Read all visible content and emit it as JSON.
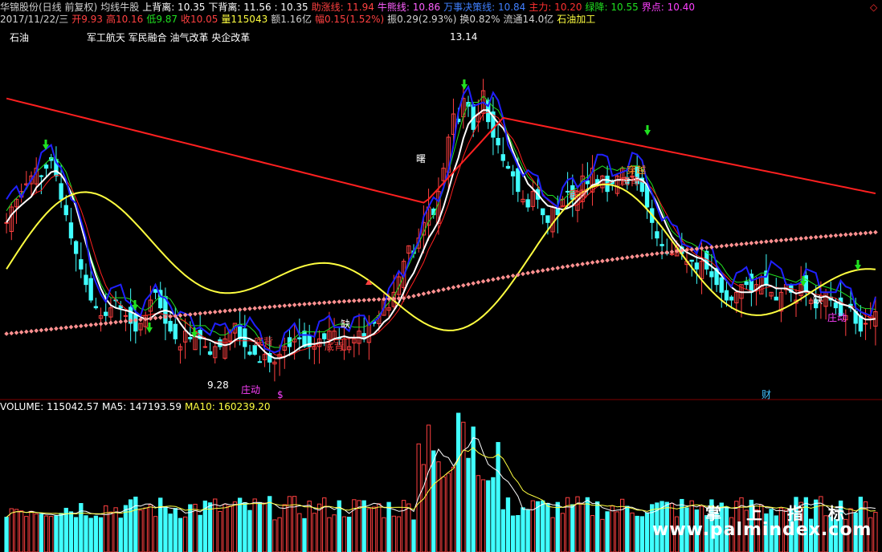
{
  "header": {
    "line1": [
      {
        "text": "华锦股份(日线 前复权)",
        "color": "#d0d0d0"
      },
      {
        "text": "均线牛股",
        "color": "#d0d0d0"
      },
      {
        "text": "上背离: 10.35",
        "color": "#ffffff"
      },
      {
        "text": "下背离: 11.56 : 10.35",
        "color": "#ffffff"
      },
      {
        "text": "助涨线: 11.94",
        "color": "#ff4040"
      },
      {
        "text": "牛熊线: 10.86",
        "color": "#ff60ff"
      },
      {
        "text": "万事决策线: 10.84",
        "color": "#4080ff"
      },
      {
        "text": "主力: 10.20",
        "color": "#ff3030"
      },
      {
        "text": "绿降: 10.55",
        "color": "#20e020"
      },
      {
        "text": "界点: 10.40",
        "color": "#ff40ff"
      }
    ],
    "line2": [
      {
        "text": "2017/11/22/三",
        "color": "#d0d0d0"
      },
      {
        "text": "开9.93",
        "color": "#ff4040"
      },
      {
        "text": "高10.16",
        "color": "#ff4040"
      },
      {
        "text": "低9.87",
        "color": "#20e020"
      },
      {
        "text": "收10.05",
        "color": "#ff4040"
      },
      {
        "text": "量115043",
        "color": "#ffff40"
      },
      {
        "text": "额1.16亿",
        "color": "#d0d0d0"
      },
      {
        "text": "幅0.15(1.52%)",
        "color": "#ff4040"
      },
      {
        "text": "振0.29(2.93%)",
        "color": "#d0d0d0"
      },
      {
        "text": "换0.82%",
        "color": "#d0d0d0"
      },
      {
        "text": "流通14.0亿",
        "color": "#d0d0d0"
      },
      {
        "text": "石油加工",
        "color": "#ffff40"
      }
    ],
    "sector": "石油",
    "concepts": "军工航天 军民融合 油气改革 央企改革"
  },
  "volume_header": [
    {
      "text": "VOLUME: 115042.57",
      "color": "#ffffff"
    },
    {
      "text": "MA5: 147193.59",
      "color": "#ffffff"
    },
    {
      "text": "MA10: 160239.20",
      "color": "#ffff40"
    }
  ],
  "annotations": {
    "high_price": "13.14",
    "low_price": "9.28",
    "labels": [
      "底背",
      "底背",
      "底背",
      "底背",
      "穿越",
      "庄动",
      "庄动",
      "曙",
      "缺",
      "缺",
      "财",
      "$"
    ]
  },
  "watermark": {
    "cn": "掌 上 指 标",
    "url": "www.palmindex.com"
  },
  "colors": {
    "up": "#ff4040",
    "down": "#40ffff",
    "background": "#000000",
    "red_ma": "#ff2020",
    "white_ma": "#ffffff",
    "blue_line": "#2020ff",
    "yellow_line": "#ffff40",
    "pink_dots": "#ff9090"
  },
  "chart_data": {
    "type": "candlestick",
    "title": "华锦股份(日线 前复权)",
    "ylim": [
      9.0,
      13.5
    ],
    "x": [
      0,
      1,
      2,
      3,
      4,
      5,
      6,
      7,
      8,
      9,
      10,
      11,
      12,
      13,
      14,
      15,
      16,
      17,
      18,
      19,
      20,
      21,
      22,
      23,
      24,
      25,
      26,
      27,
      28,
      29,
      30,
      31,
      32,
      33,
      34,
      35,
      36,
      37,
      38,
      39,
      40,
      41,
      42,
      43,
      44,
      45,
      46,
      47,
      48,
      49,
      50,
      51,
      52,
      53,
      54,
      55,
      56,
      57,
      58,
      59,
      60,
      61,
      62,
      63,
      64,
      65,
      66,
      67,
      68,
      69,
      70,
      71,
      72,
      73,
      74,
      75,
      76,
      77,
      78,
      79,
      80,
      81,
      82,
      83,
      84,
      85,
      86,
      87,
      88,
      89,
      90,
      91,
      92,
      93,
      94,
      95,
      96,
      97,
      98,
      99,
      100,
      101,
      102,
      103,
      104,
      105,
      106,
      107,
      108,
      109,
      110,
      111,
      112,
      113,
      114,
      115,
      116,
      117,
      118,
      119,
      120,
      121,
      122,
      123,
      124,
      125,
      126,
      127,
      128,
      129,
      130,
      131,
      132,
      133,
      134,
      135,
      136,
      137,
      138,
      139,
      140,
      141,
      142,
      143,
      144,
      145,
      146,
      147,
      148,
      149,
      150,
      151,
      152,
      153,
      154,
      155,
      156,
      157,
      158,
      159,
      160,
      161,
      162,
      163,
      164,
      165,
      166,
      167,
      168,
      169,
      170,
      171,
      172,
      173,
      174,
      175,
      176,
      177,
      178,
      179,
      180
    ],
    "close_approx": [
      11.2,
      11.4,
      11.5,
      11.6,
      11.7,
      11.8,
      11.9,
      11.8,
      11.9,
      12.0,
      11.8,
      11.5,
      11.3,
      11.0,
      10.8,
      10.6,
      10.4,
      10.2,
      10.1,
      10.0,
      10.0,
      10.1,
      10.2,
      10.1,
      10.0,
      9.9,
      9.8,
      9.9,
      10.0,
      10.2,
      10.3,
      10.1,
      9.9,
      9.8,
      9.7,
      9.6,
      9.8,
      9.7,
      9.8,
      9.7,
      9.6,
      9.5,
      9.6,
      9.6,
      9.7,
      9.8,
      9.9,
      9.7,
      9.6,
      9.5,
      9.5,
      9.4,
      9.5,
      9.4,
      9.4,
      9.5,
      9.6,
      9.6,
      9.7,
      9.7,
      9.6,
      9.6,
      9.6,
      9.7,
      9.7,
      9.8,
      9.8,
      9.7,
      9.7,
      9.6,
      9.7,
      9.8,
      9.7,
      9.9,
      9.9,
      10.0,
      10.2,
      10.1,
      10.3,
      10.5,
      10.7,
      10.9,
      10.8,
      11.0,
      11.2,
      11.4,
      11.3,
      11.6,
      11.9,
      12.3,
      12.6,
      12.5,
      12.8,
      12.7,
      12.4,
      12.6,
      12.9,
      12.5,
      12.3,
      12.2,
      12.0,
      11.9,
      11.8,
      11.6,
      11.5,
      11.4,
      11.6,
      11.5,
      11.3,
      11.2,
      11.4,
      11.3,
      11.5,
      11.6,
      11.5,
      11.6,
      11.8,
      11.7,
      11.9,
      11.7,
      11.8,
      11.6,
      11.7,
      11.8,
      11.9,
      11.7,
      11.8,
      11.7,
      11.6,
      11.4,
      11.2,
      11.0,
      10.9,
      10.8,
      10.8,
      10.9,
      10.8,
      10.7,
      10.7,
      10.6,
      10.7,
      10.6,
      10.5,
      10.4,
      10.3,
      10.2,
      10.2,
      10.3,
      10.4,
      10.4,
      10.3,
      10.4,
      10.5,
      10.4,
      10.3,
      10.2,
      10.3,
      10.4,
      10.3,
      10.2,
      10.4,
      10.3,
      10.2,
      10.1,
      10.2,
      10.3,
      10.2,
      10.1,
      10.0,
      10.0,
      10.1,
      9.9,
      9.8,
      9.9,
      10.0,
      10.05
    ],
    "volume_max": 520000,
    "markers": {
      "high": 13.14,
      "low": 9.28
    }
  }
}
